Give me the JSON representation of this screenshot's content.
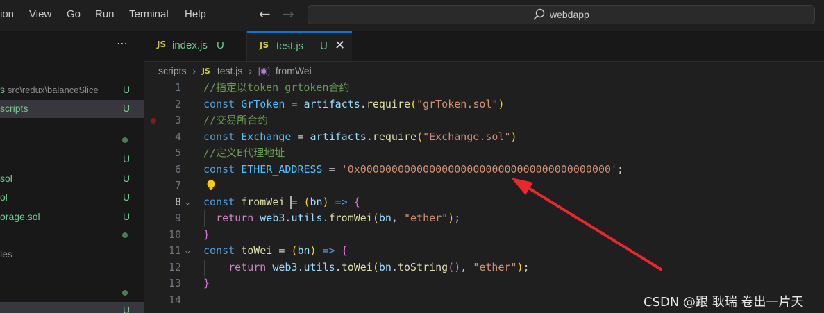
{
  "menu": [
    "ion",
    "View",
    "Go",
    "Run",
    "Terminal",
    "Help"
  ],
  "search": {
    "text": "webdapp"
  },
  "sidebar": {
    "more_label": "⋯",
    "rows": [
      {
        "path": "s",
        "dim": "src\\redux\\balanceSlice",
        "status": "U"
      },
      {
        "path": "scripts",
        "status": "U"
      },
      {
        "status_dot": true
      },
      {
        "status": "U"
      },
      {
        "path": "sol",
        "status": "U"
      },
      {
        "path": "ol",
        "status": "U"
      },
      {
        "path": "orage.sol",
        "status": "U"
      },
      {
        "status_dot": true
      },
      {
        "path": "les"
      },
      {
        "status_dot": true
      },
      {
        "status": "U"
      }
    ]
  },
  "tabs": [
    {
      "badge": "JS",
      "name": "index.js",
      "status": "U"
    },
    {
      "badge": "JS",
      "name": "test.js",
      "status": "U",
      "close": "✕"
    }
  ],
  "breadcrumb": {
    "folder": "scripts",
    "badge": "JS",
    "file": "test.js",
    "symbol": "fromWei"
  },
  "editor": {
    "current_line": 8,
    "lines": [
      {
        "n": "1",
        "text": "//指定以token grtoken合约"
      },
      {
        "n": "2",
        "text": "const GrToken = artifacts.require(\"grToken.sol\")"
      },
      {
        "n": "3",
        "text": "//交易所合约"
      },
      {
        "n": "4",
        "text": "const Exchange = artifacts.require(\"Exchange.sol\")"
      },
      {
        "n": "5",
        "text": "//定义E代理地址"
      },
      {
        "n": "6",
        "text": "const ETHER_ADDRESS = '0x0000000000000000000000000000000000000000';"
      },
      {
        "n": "7",
        "text": ""
      },
      {
        "n": "8",
        "text": "const fromWei = (bn) => {"
      },
      {
        "n": "9",
        "text": "  return web3.utils.fromWei(bn, \"ether\");"
      },
      {
        "n": "10",
        "text": "}"
      },
      {
        "n": "11",
        "text": "const toWei = (bn) => {"
      },
      {
        "n": "12",
        "text": "    return web3.utils.toWei(bn.toString(), \"ether\");"
      },
      {
        "n": "13",
        "text": "}"
      },
      {
        "n": "14",
        "text": ""
      }
    ]
  },
  "watermark": "CSDN @跟 耿瑞 卷出一片天",
  "colors": {
    "accent": "#0078d4",
    "git_untracked": "#73c991",
    "annotation_arrow": "#e8282b"
  }
}
